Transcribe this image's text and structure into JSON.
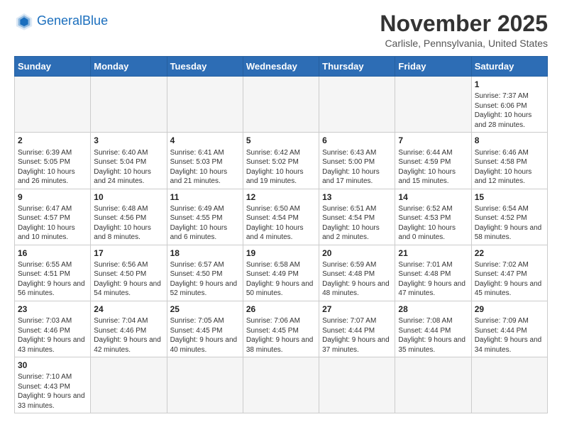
{
  "header": {
    "logo_general": "General",
    "logo_blue": "Blue",
    "month_title": "November 2025",
    "location": "Carlisle, Pennsylvania, United States"
  },
  "days_of_week": [
    "Sunday",
    "Monday",
    "Tuesday",
    "Wednesday",
    "Thursday",
    "Friday",
    "Saturday"
  ],
  "weeks": [
    [
      {
        "day": "",
        "info": ""
      },
      {
        "day": "",
        "info": ""
      },
      {
        "day": "",
        "info": ""
      },
      {
        "day": "",
        "info": ""
      },
      {
        "day": "",
        "info": ""
      },
      {
        "day": "",
        "info": ""
      },
      {
        "day": "1",
        "info": "Sunrise: 7:37 AM\nSunset: 6:06 PM\nDaylight: 10 hours\nand 28 minutes."
      }
    ],
    [
      {
        "day": "2",
        "info": "Sunrise: 6:39 AM\nSunset: 5:05 PM\nDaylight: 10 hours\nand 26 minutes."
      },
      {
        "day": "3",
        "info": "Sunrise: 6:40 AM\nSunset: 5:04 PM\nDaylight: 10 hours\nand 24 minutes."
      },
      {
        "day": "4",
        "info": "Sunrise: 6:41 AM\nSunset: 5:03 PM\nDaylight: 10 hours\nand 21 minutes."
      },
      {
        "day": "5",
        "info": "Sunrise: 6:42 AM\nSunset: 5:02 PM\nDaylight: 10 hours\nand 19 minutes."
      },
      {
        "day": "6",
        "info": "Sunrise: 6:43 AM\nSunset: 5:00 PM\nDaylight: 10 hours\nand 17 minutes."
      },
      {
        "day": "7",
        "info": "Sunrise: 6:44 AM\nSunset: 4:59 PM\nDaylight: 10 hours\nand 15 minutes."
      },
      {
        "day": "8",
        "info": "Sunrise: 6:46 AM\nSunset: 4:58 PM\nDaylight: 10 hours\nand 12 minutes."
      }
    ],
    [
      {
        "day": "9",
        "info": "Sunrise: 6:47 AM\nSunset: 4:57 PM\nDaylight: 10 hours\nand 10 minutes."
      },
      {
        "day": "10",
        "info": "Sunrise: 6:48 AM\nSunset: 4:56 PM\nDaylight: 10 hours\nand 8 minutes."
      },
      {
        "day": "11",
        "info": "Sunrise: 6:49 AM\nSunset: 4:55 PM\nDaylight: 10 hours\nand 6 minutes."
      },
      {
        "day": "12",
        "info": "Sunrise: 6:50 AM\nSunset: 4:54 PM\nDaylight: 10 hours\nand 4 minutes."
      },
      {
        "day": "13",
        "info": "Sunrise: 6:51 AM\nSunset: 4:54 PM\nDaylight: 10 hours\nand 2 minutes."
      },
      {
        "day": "14",
        "info": "Sunrise: 6:52 AM\nSunset: 4:53 PM\nDaylight: 10 hours\nand 0 minutes."
      },
      {
        "day": "15",
        "info": "Sunrise: 6:54 AM\nSunset: 4:52 PM\nDaylight: 9 hours\nand 58 minutes."
      }
    ],
    [
      {
        "day": "16",
        "info": "Sunrise: 6:55 AM\nSunset: 4:51 PM\nDaylight: 9 hours\nand 56 minutes."
      },
      {
        "day": "17",
        "info": "Sunrise: 6:56 AM\nSunset: 4:50 PM\nDaylight: 9 hours\nand 54 minutes."
      },
      {
        "day": "18",
        "info": "Sunrise: 6:57 AM\nSunset: 4:50 PM\nDaylight: 9 hours\nand 52 minutes."
      },
      {
        "day": "19",
        "info": "Sunrise: 6:58 AM\nSunset: 4:49 PM\nDaylight: 9 hours\nand 50 minutes."
      },
      {
        "day": "20",
        "info": "Sunrise: 6:59 AM\nSunset: 4:48 PM\nDaylight: 9 hours\nand 48 minutes."
      },
      {
        "day": "21",
        "info": "Sunrise: 7:01 AM\nSunset: 4:48 PM\nDaylight: 9 hours\nand 47 minutes."
      },
      {
        "day": "22",
        "info": "Sunrise: 7:02 AM\nSunset: 4:47 PM\nDaylight: 9 hours\nand 45 minutes."
      }
    ],
    [
      {
        "day": "23",
        "info": "Sunrise: 7:03 AM\nSunset: 4:46 PM\nDaylight: 9 hours\nand 43 minutes."
      },
      {
        "day": "24",
        "info": "Sunrise: 7:04 AM\nSunset: 4:46 PM\nDaylight: 9 hours\nand 42 minutes."
      },
      {
        "day": "25",
        "info": "Sunrise: 7:05 AM\nSunset: 4:45 PM\nDaylight: 9 hours\nand 40 minutes."
      },
      {
        "day": "26",
        "info": "Sunrise: 7:06 AM\nSunset: 4:45 PM\nDaylight: 9 hours\nand 38 minutes."
      },
      {
        "day": "27",
        "info": "Sunrise: 7:07 AM\nSunset: 4:44 PM\nDaylight: 9 hours\nand 37 minutes."
      },
      {
        "day": "28",
        "info": "Sunrise: 7:08 AM\nSunset: 4:44 PM\nDaylight: 9 hours\nand 35 minutes."
      },
      {
        "day": "29",
        "info": "Sunrise: 7:09 AM\nSunset: 4:44 PM\nDaylight: 9 hours\nand 34 minutes."
      }
    ],
    [
      {
        "day": "30",
        "info": "Sunrise: 7:10 AM\nSunset: 4:43 PM\nDaylight: 9 hours\nand 33 minutes."
      },
      {
        "day": "",
        "info": ""
      },
      {
        "day": "",
        "info": ""
      },
      {
        "day": "",
        "info": ""
      },
      {
        "day": "",
        "info": ""
      },
      {
        "day": "",
        "info": ""
      },
      {
        "day": "",
        "info": ""
      }
    ]
  ]
}
